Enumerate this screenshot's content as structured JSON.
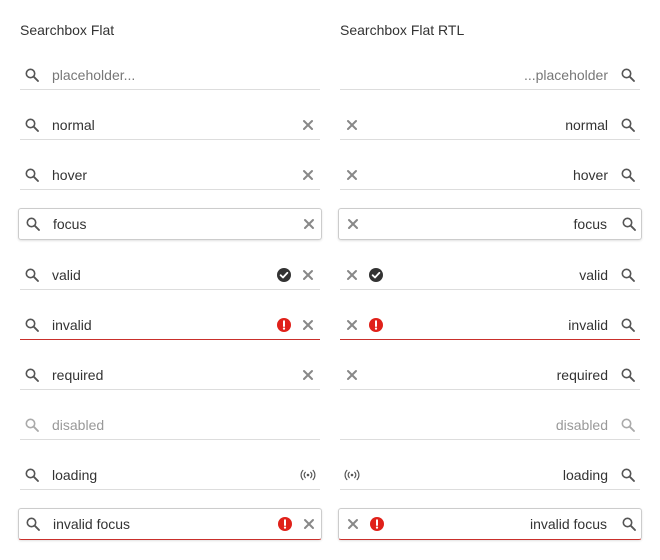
{
  "colors": {
    "text": "#333333",
    "placeholder": "#777777",
    "disabled": "#999999",
    "underline": "#dddddd",
    "invalid": "#c9302c",
    "icon": "#555555",
    "clear_icon": "#888888",
    "valid_icon": "#333333",
    "invalid_icon": "#e0211a"
  },
  "ltr": {
    "title": "Searchbox Flat",
    "rows": {
      "placeholder": {
        "placeholder": "placeholder..."
      },
      "normal": {
        "value": "normal"
      },
      "hover": {
        "value": "hover"
      },
      "focus": {
        "value": "focus"
      },
      "valid": {
        "value": "valid"
      },
      "invalid": {
        "value": "invalid"
      },
      "required": {
        "value": "required"
      },
      "disabled": {
        "value": "disabled"
      },
      "loading": {
        "value": "loading"
      },
      "invalid_focus": {
        "value": "invalid focus"
      }
    }
  },
  "rtl": {
    "title": "Searchbox Flat RTL",
    "rows": {
      "placeholder": {
        "placeholder": "...placeholder"
      },
      "normal": {
        "value": "normal"
      },
      "hover": {
        "value": "hover"
      },
      "focus": {
        "value": "focus"
      },
      "valid": {
        "value": "valid"
      },
      "invalid": {
        "value": "invalid"
      },
      "required": {
        "value": "required"
      },
      "disabled": {
        "value": "disabled"
      },
      "loading": {
        "value": "loading"
      },
      "invalid_focus": {
        "value": "invalid focus"
      }
    }
  },
  "icons": {
    "search": "search-icon",
    "clear": "close-icon",
    "valid": "check-circle-icon",
    "invalid": "error-circle-icon",
    "loading": "loading-icon"
  }
}
